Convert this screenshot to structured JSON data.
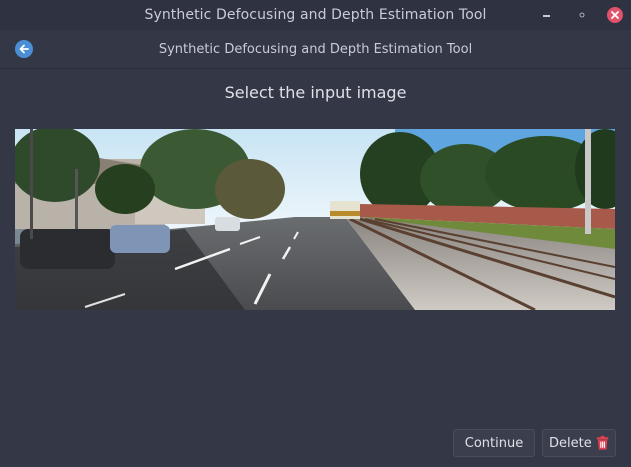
{
  "window": {
    "title": "Synthetic Defocusing and Depth Estimation Tool"
  },
  "header": {
    "title": "Synthetic Defocusing and Depth Estimation Tool",
    "back_icon": "back-arrow-icon"
  },
  "main": {
    "prompt": "Select the input image",
    "image_description_icon": "street-photo"
  },
  "footer": {
    "continue_label": "Continue",
    "delete_label": "Delete",
    "delete_icon": "trash-icon"
  },
  "colors": {
    "background": "#343746",
    "titlebar": "#2f3241",
    "accent": "#4a8fd6",
    "close": "#e0536a",
    "delete_icon": "#e0404f"
  }
}
